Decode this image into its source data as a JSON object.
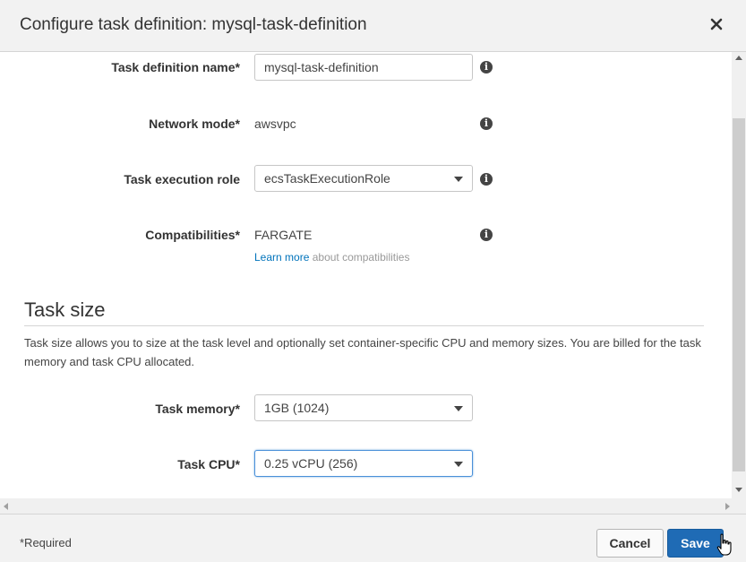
{
  "dialog": {
    "title": "Configure task definition: mysql-task-definition",
    "close_icon": "close-icon"
  },
  "form": {
    "task_definition_name": {
      "label": "Task definition name*",
      "value": "mysql-task-definition"
    },
    "network_mode": {
      "label": "Network mode*",
      "value": "awsvpc"
    },
    "task_execution_role": {
      "label": "Task execution role",
      "value": "ecsTaskExecutionRole"
    },
    "compatibilities": {
      "label": "Compatibilities*",
      "value": "FARGATE",
      "learn_more": "Learn more",
      "learn_more_rest": "about compatibilities"
    }
  },
  "task_size": {
    "title": "Task size",
    "description": "Task size allows you to size at the task level and optionally set container-specific CPU and memory sizes. You are billed for the task memory and task CPU allocated.",
    "task_memory": {
      "label": "Task memory*",
      "value": "1GB (1024)"
    },
    "task_cpu": {
      "label": "Task CPU*",
      "value": "0.25 vCPU (256)"
    }
  },
  "footer": {
    "required_note": "*Required",
    "cancel_label": "Cancel",
    "save_label": "Save"
  },
  "colors": {
    "primary_button": "#1f6bb5",
    "link": "#0073bb"
  }
}
